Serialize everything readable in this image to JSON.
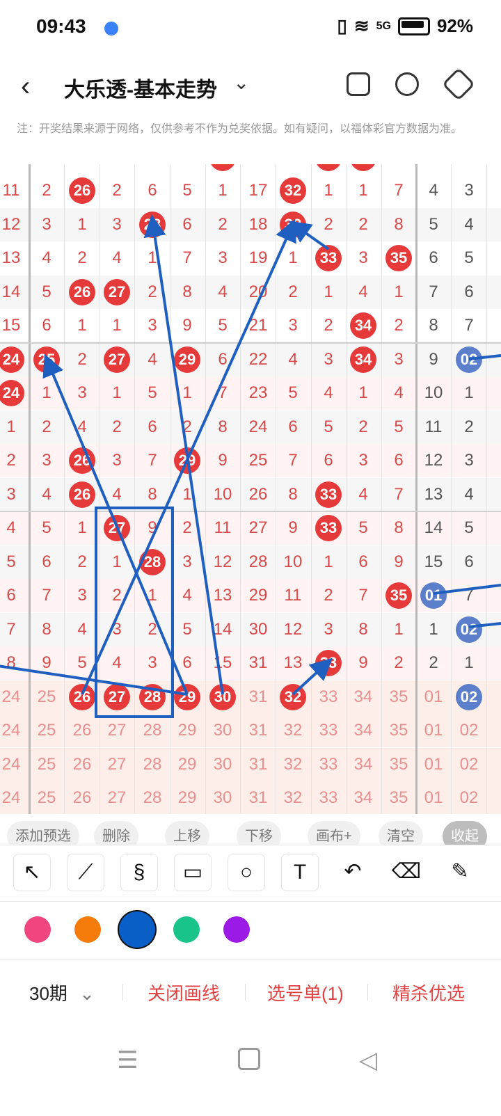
{
  "status": {
    "time": "09:43",
    "battery": "92%",
    "network": "5G"
  },
  "header": {
    "title": "大乐透-基本走势",
    "icons": [
      "back-arrow-icon",
      "chevron-down-icon",
      "layout-icon",
      "share-icon",
      "settings-hex-icon"
    ]
  },
  "note": "注：开奖结果来源于网络，仅供参考不作为兑奖依据。如有疑问，以福体彩官方数据为准。",
  "grid": {
    "rows": [
      [
        "11",
        "2",
        "26",
        "2",
        "6",
        "5",
        "1",
        "17",
        "32",
        "1",
        "1",
        "7",
        "4",
        "3"
      ],
      [
        "12",
        "3",
        "1",
        "3",
        "28",
        "6",
        "2",
        "18",
        "32",
        "2",
        "2",
        "8",
        "5",
        "4"
      ],
      [
        "13",
        "4",
        "2",
        "4",
        "1",
        "7",
        "3",
        "19",
        "1",
        "33",
        "3",
        "35",
        "6",
        "5"
      ],
      [
        "14",
        "5",
        "26",
        "27",
        "2",
        "8",
        "4",
        "20",
        "2",
        "1",
        "4",
        "1",
        "7",
        "6"
      ],
      [
        "15",
        "6",
        "1",
        "1",
        "3",
        "9",
        "5",
        "21",
        "3",
        "2",
        "34",
        "2",
        "8",
        "7"
      ],
      [
        "24",
        "25",
        "2",
        "27",
        "4",
        "29",
        "6",
        "22",
        "4",
        "3",
        "34",
        "3",
        "9",
        "02"
      ],
      [
        "24",
        "1",
        "3",
        "1",
        "5",
        "1",
        "7",
        "23",
        "5",
        "4",
        "1",
        "4",
        "10",
        "1"
      ],
      [
        "1",
        "2",
        "4",
        "2",
        "6",
        "2",
        "8",
        "24",
        "6",
        "5",
        "2",
        "5",
        "11",
        "2"
      ],
      [
        "2",
        "3",
        "26",
        "3",
        "7",
        "29",
        "9",
        "25",
        "7",
        "6",
        "3",
        "6",
        "12",
        "3"
      ],
      [
        "3",
        "4",
        "26",
        "4",
        "8",
        "1",
        "10",
        "26",
        "8",
        "33",
        "4",
        "7",
        "13",
        "4"
      ],
      [
        "4",
        "5",
        "1",
        "27",
        "9",
        "2",
        "11",
        "27",
        "9",
        "33",
        "5",
        "8",
        "14",
        "5"
      ],
      [
        "5",
        "6",
        "2",
        "1",
        "28",
        "3",
        "12",
        "28",
        "10",
        "1",
        "6",
        "9",
        "15",
        "6"
      ],
      [
        "6",
        "7",
        "3",
        "2",
        "1",
        "4",
        "13",
        "29",
        "11",
        "2",
        "7",
        "35",
        "01",
        "7"
      ],
      [
        "7",
        "8",
        "4",
        "3",
        "2",
        "5",
        "14",
        "30",
        "12",
        "3",
        "8",
        "1",
        "1",
        "02"
      ],
      [
        "8",
        "9",
        "5",
        "4",
        "3",
        "6",
        "15",
        "31",
        "13",
        "33",
        "9",
        "2",
        "2",
        "1"
      ],
      [
        "24",
        "25",
        "26",
        "27",
        "28",
        "29",
        "30",
        "31",
        "32",
        "33",
        "34",
        "35",
        "01",
        "02"
      ],
      [
        "24",
        "25",
        "26",
        "27",
        "28",
        "29",
        "30",
        "31",
        "32",
        "33",
        "34",
        "35",
        "01",
        "02"
      ],
      [
        "24",
        "25",
        "26",
        "27",
        "28",
        "29",
        "30",
        "31",
        "32",
        "33",
        "34",
        "35",
        "01",
        "02"
      ],
      [
        "24",
        "25",
        "26",
        "27",
        "28",
        "29",
        "30",
        "31",
        "32",
        "33",
        "34",
        "35",
        "01",
        "02"
      ]
    ],
    "highlighted": [
      [
        0,
        2
      ],
      [
        0,
        8
      ],
      [
        1,
        4
      ],
      [
        1,
        8
      ],
      [
        2,
        9
      ],
      [
        2,
        11
      ],
      [
        3,
        2
      ],
      [
        3,
        3
      ],
      [
        4,
        10
      ],
      [
        5,
        0
      ],
      [
        5,
        1
      ],
      [
        5,
        3
      ],
      [
        5,
        5
      ],
      [
        5,
        10
      ],
      [
        5,
        13
      ],
      [
        6,
        0
      ],
      [
        8,
        2
      ],
      [
        8,
        5
      ],
      [
        9,
        2
      ],
      [
        9,
        9
      ],
      [
        10,
        3
      ],
      [
        10,
        9
      ],
      [
        11,
        4
      ],
      [
        12,
        11
      ],
      [
        12,
        12
      ],
      [
        13,
        13
      ],
      [
        14,
        9
      ],
      [
        15,
        2
      ],
      [
        15,
        3
      ],
      [
        15,
        4
      ],
      [
        15,
        5
      ],
      [
        15,
        6
      ],
      [
        15,
        8
      ],
      [
        15,
        13
      ]
    ]
  },
  "actions": [
    "添加预选",
    "删除",
    "上移",
    "下移",
    "画布+",
    "清空",
    "收起"
  ],
  "tools": [
    "arrow-tool-icon",
    "line-tool-icon",
    "freehand-tool-icon",
    "rectangle-tool-icon",
    "circle-tool-icon",
    "text-tool-icon",
    "undo-icon",
    "eraser-icon",
    "clear-brush-icon"
  ],
  "tool_glyphs": [
    "↖",
    "⟋",
    "§",
    "▭",
    "○",
    "T",
    "↶",
    "⌫",
    "✎"
  ],
  "palette": [
    "#f0457f",
    "#f57c0a",
    "#0a5fc7",
    "#19c48a",
    "#9b1ae6"
  ],
  "bottom": {
    "period": "30期",
    "close_draw": "关闭画线",
    "selection": "选号单(1)",
    "premium": "精杀优选"
  },
  "nav": [
    "menu-icon",
    "home-square-icon",
    "back-triangle-icon"
  ]
}
